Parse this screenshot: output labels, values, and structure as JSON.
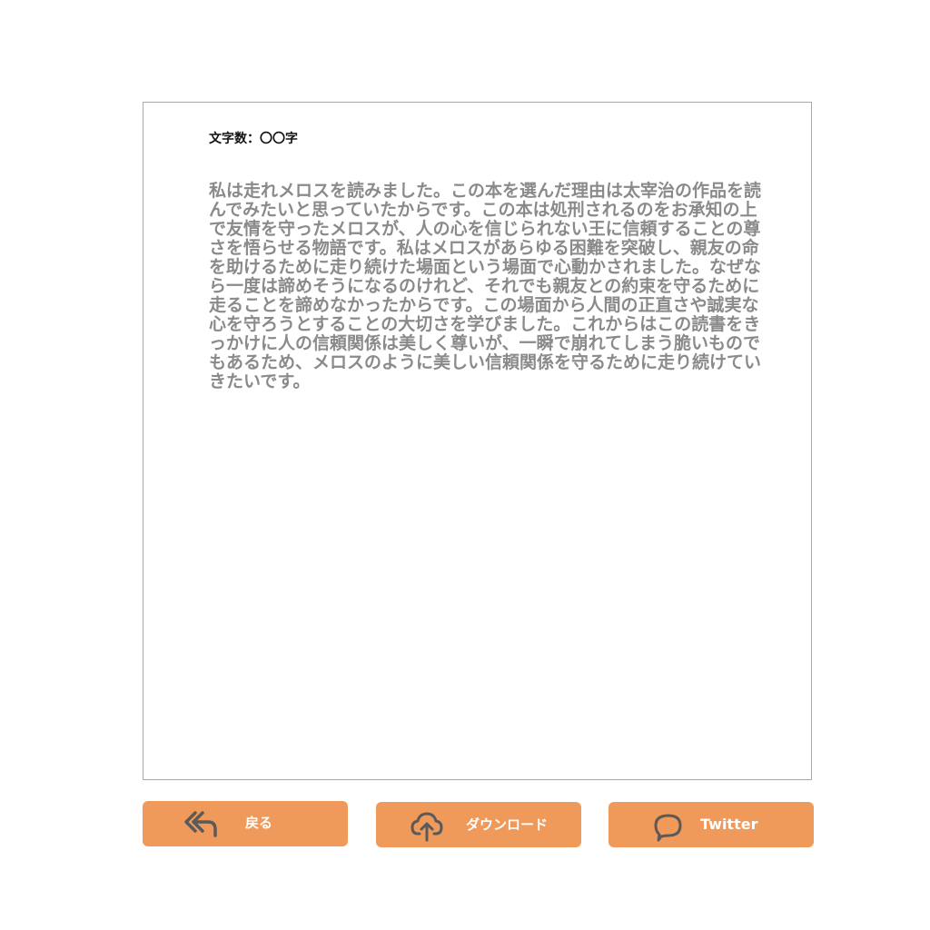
{
  "editor": {
    "char_count_label": "文字数：〇〇字",
    "essay_text": "私は走れメロスを読みました。この本を選んだ理由は太宰治の作品を読んでみたいと思っていたからです。この本は処刑されるのをお承知の上で友情を守ったメロスが、人の心を信じられない王に信頼することの尊さを悟らせる物語です。私はメロスがあらゆる困難を突破し、親友の命を助けるために走り続けた場面という場面で心動かされました。なぜなら一度は諦めそうになるのけれど、それでも親友との約束を守るために走ることを諦めなかったからです。この場面から人間の正直さや誠実な心を守ろうとすることの大切さを学びました。これからはこの読書をきっかけに人の信頼関係は美しく尊いが、一瞬で崩れてしまう脆いものでもあるため、メロスのように美しい信頼関係を守るために走り続けていきたいです。"
  },
  "actions": {
    "back": {
      "label": "戻る",
      "icon": "reply-all-icon"
    },
    "download": {
      "label": "ダウンロード",
      "icon": "cloud-upload-icon"
    },
    "twitter": {
      "label": "Twitter",
      "icon": "speech-bubble-icon"
    }
  },
  "colors": {
    "button_bg": "#ef995a",
    "button_text": "#ffffff",
    "icon": "#5a5a5a",
    "essay_text": "#8a8a8a",
    "border": "#a9a9a9"
  }
}
